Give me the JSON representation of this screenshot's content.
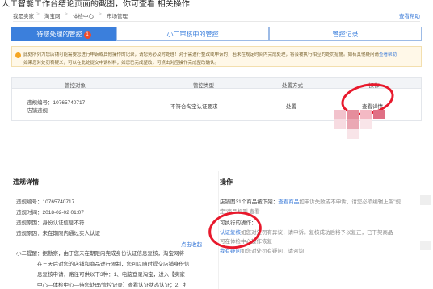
{
  "top_cut_text": "人工智能工作台结论页面的截图，你可查看 相关操作",
  "breadcrumb": {
    "items": [
      "我是卖家",
      "淘宝网",
      "体检中心",
      "市场管理"
    ],
    "separator": ">",
    "help": "查看帮助"
  },
  "tabs": [
    {
      "label": "待您处理的管控",
      "badge": "1",
      "active": true
    },
    {
      "label": "小二审核中的管控",
      "active": false
    },
    {
      "label": "管控记录",
      "active": false
    }
  ],
  "notice": {
    "line1": "此处所列为您店铺可能需要您进行申诉或其他操作的记录，请您务必及时处理！对于需进行整改或申诉的，若未在规定时间内完成处理，将会被执行相应的处罚措施。如有其他疑问请",
    "line1_link": "查看帮助",
    "line2": "如果您对处罚有疑义，可以在此处提交申诉材料；如您已完成整改，可点击对应操作完成整改确认。"
  },
  "table": {
    "headers": [
      "管控对象",
      "管控类型",
      "处置方式",
      "操作"
    ],
    "row": {
      "object_line1": "违规编号：10765740717",
      "object_line2": "店铺违规",
      "type": "不符合淘宝认证要求",
      "action": "处置",
      "operation": "查看详情"
    }
  },
  "details": {
    "title": "违规详情",
    "lines": [
      "违规编号：10765740717",
      "违规时间：2018-02-02 01:07",
      "违规原因：身份认证信息不符",
      "违规原因：未在期限内通过实人认证"
    ],
    "expand": "点击收起",
    "tip_lines": [
      "小二提醒：据勘察，由于您未在期限内完成身份认证信息复核，淘宝网将",
      "在三天后对您的店铺和商品进行限制，您可以随时提交店铺身份信",
      "息复核申请，路径可供以下3种：1、电脑登录淘宝，进入【卖家",
      "中心—体检中心—待您处理/管控记录】查看认证状态认证；2、打"
    ]
  },
  "operations": {
    "title": "操作",
    "line1_prefix": "店铺图31个商品被下架：",
    "line1_link": "查看商品",
    "line1_suffix": "如申诉失败或不申诉，请您必须编辑上架\"规",
    "line2": "定\"商品规则 查看",
    "exec_label": "可执行的操作：",
    "op1_link": "认证复核",
    "op1_text": "如您对处罚有异议，请申诉。复核成功后将予以复正，已下架商品",
    "op1_text2": "可在体检中心操作恢复",
    "op2_link": "我有疑问",
    "op2_text": "如您对处罚有疑问，请咨询"
  },
  "colors": {
    "accent": "#3b7fdc",
    "badge": "#f04a2a",
    "annotation": "#e8192c"
  }
}
